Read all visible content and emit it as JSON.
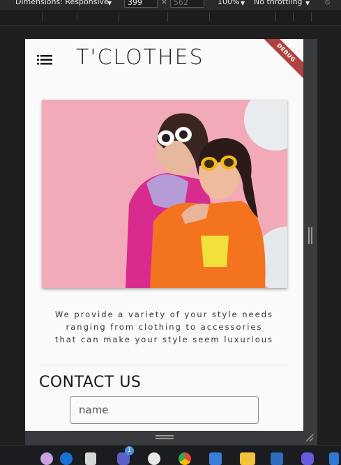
{
  "devtools": {
    "dimensions_label": "Dimensions: Responsive",
    "width_value": "399",
    "height_placeholder": "562",
    "times": "×",
    "zoom": "100%",
    "throttling": "No throttling"
  },
  "app": {
    "title": "T'CLOTHES",
    "debug_banner": "DEBUG",
    "description_lines": [
      "We provide a variety of your style needs",
      "ranging from clothing to accessories",
      "that can make your style seem luxurious"
    ],
    "contact_heading": "CONTACT US",
    "name_field": {
      "placeholder": "name",
      "value": ""
    }
  },
  "taskbar": {
    "badge_count": "1",
    "icons": [
      "paint-icon",
      "globe-icon",
      "window-icon",
      "teams-icon",
      "phone-icon",
      "chrome-icon",
      "myob-icon",
      "folder-icon",
      "mail-icon",
      "copilot-icon",
      "store-icon"
    ]
  }
}
